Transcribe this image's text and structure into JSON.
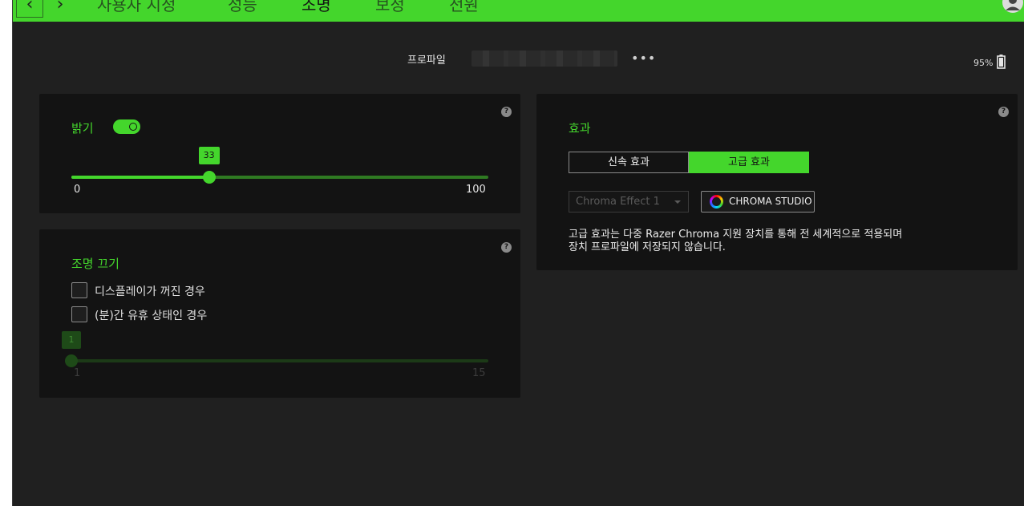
{
  "nav": {
    "back_icon": "‹",
    "forward_icon": "›",
    "tabs": [
      {
        "label": "사용자 지정",
        "active": false
      },
      {
        "label": "성능",
        "active": false
      },
      {
        "label": "조명",
        "active": true
      },
      {
        "label": "보정",
        "active": false
      },
      {
        "label": "전원",
        "active": false
      }
    ]
  },
  "profile": {
    "label": "프로파일",
    "more_icon": "•••"
  },
  "battery": {
    "percent_text": "95%"
  },
  "brightness": {
    "title": "밝기",
    "help": "?",
    "enabled": true,
    "value": 33,
    "value_label": "33",
    "min": 0,
    "max": 100,
    "min_label": "0",
    "max_label": "100"
  },
  "lighting_off": {
    "title": "조명 끄기",
    "help": "?",
    "options": [
      {
        "label": "디스플레이가 꺼진 경우",
        "checked": false
      },
      {
        "label": "(분)간 유휴 상태인 경우",
        "checked": false
      }
    ],
    "value": 1,
    "value_label": "1",
    "min": 1,
    "max": 15,
    "min_label": "1",
    "max_label": "15"
  },
  "effects": {
    "title": "효과",
    "help": "?",
    "quick_label": "신속 효과",
    "advanced_label": "고급 효과",
    "selected": "advanced",
    "dropdown_value": "Chroma Effect 1",
    "chroma_studio_label": "CHROMA STUDIO",
    "description_line1": "고급 효과는 다중 Razer Chroma 지원 장치를 통해 전 세계적으로 적용되며",
    "description_line2": "장치 프로파일에 저장되지 않습니다."
  },
  "colors": {
    "accent": "#44d62c",
    "background": "#202020",
    "panel": "#131313",
    "disabled_green": "#1e4a18"
  }
}
